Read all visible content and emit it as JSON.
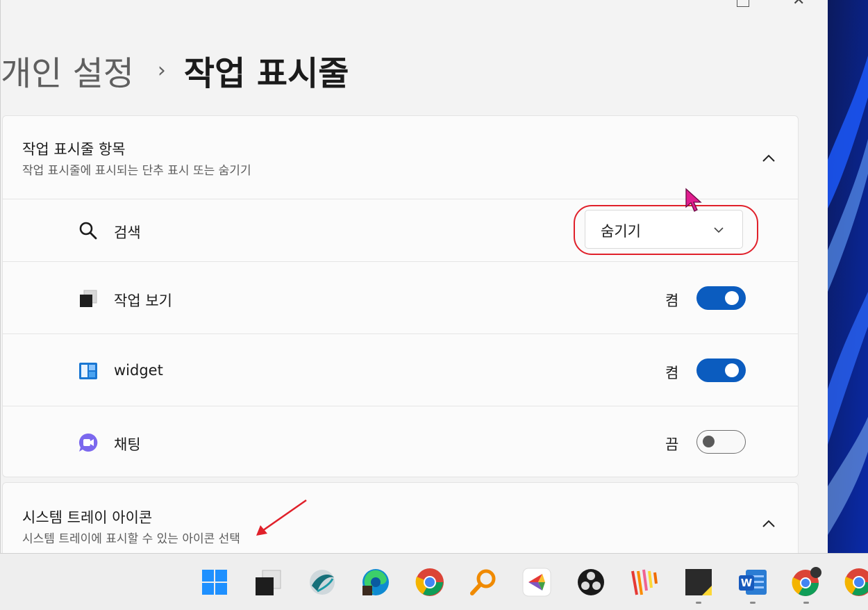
{
  "breadcrumb": {
    "parent": "개인 설정",
    "separator": "›",
    "current": "작업 표시줄"
  },
  "taskbar_items_section": {
    "title": "작업 표시줄 항목",
    "subtitle": "작업 표시줄에 표시되는 단추 표시 또는 숨기기",
    "rows": [
      {
        "label": "검색",
        "icon": "search-icon",
        "control": "dropdown",
        "value": "숨기기"
      },
      {
        "label": "작업 보기",
        "icon": "task-view-icon",
        "control": "toggle",
        "state_label": "켬",
        "on": true
      },
      {
        "label": "widget",
        "icon": "widgets-icon",
        "control": "toggle",
        "state_label": "켬",
        "on": true
      },
      {
        "label": "채팅",
        "icon": "chat-icon",
        "control": "toggle",
        "state_label": "끔",
        "on": false
      }
    ]
  },
  "system_tray_section": {
    "title": "시스템 트레이 아이콘",
    "subtitle": "시스템 트레이에 표시할 수 있는 아이콘 선택"
  },
  "taskbar_apps": [
    {
      "name": "start-icon"
    },
    {
      "name": "task-view-icon"
    },
    {
      "name": "browser-icon"
    },
    {
      "name": "edge-icon"
    },
    {
      "name": "chrome-icon"
    },
    {
      "name": "search-tool-icon"
    },
    {
      "name": "app-icon"
    },
    {
      "name": "obs-icon"
    },
    {
      "name": "stripes-app-icon"
    },
    {
      "name": "sticky-notes-icon"
    },
    {
      "name": "word-icon"
    },
    {
      "name": "chrome-profile-icon"
    },
    {
      "name": "chrome-icon"
    }
  ],
  "colors": {
    "accent": "#0b5cbf",
    "highlight": "#e0202a",
    "cursor": "#e01d8e"
  }
}
